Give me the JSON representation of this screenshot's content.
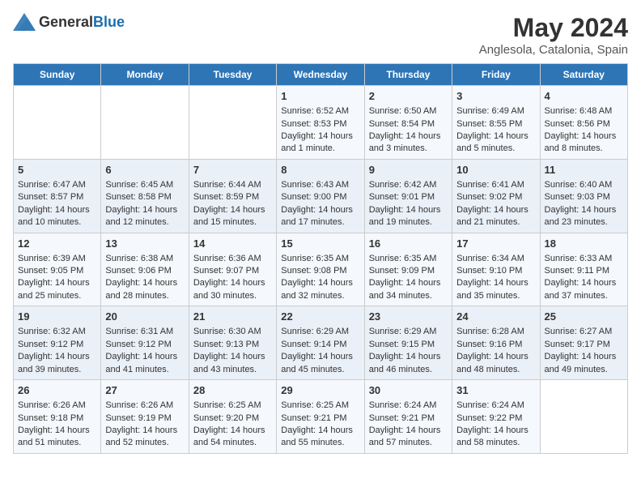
{
  "logo": {
    "text_general": "General",
    "text_blue": "Blue"
  },
  "title": "May 2024",
  "subtitle": "Anglesola, Catalonia, Spain",
  "days_header": [
    "Sunday",
    "Monday",
    "Tuesday",
    "Wednesday",
    "Thursday",
    "Friday",
    "Saturday"
  ],
  "weeks": [
    [
      {
        "day": "",
        "info": ""
      },
      {
        "day": "",
        "info": ""
      },
      {
        "day": "",
        "info": ""
      },
      {
        "day": "1",
        "info": "Sunrise: 6:52 AM\nSunset: 8:53 PM\nDaylight: 14 hours\nand 1 minute."
      },
      {
        "day": "2",
        "info": "Sunrise: 6:50 AM\nSunset: 8:54 PM\nDaylight: 14 hours\nand 3 minutes."
      },
      {
        "day": "3",
        "info": "Sunrise: 6:49 AM\nSunset: 8:55 PM\nDaylight: 14 hours\nand 5 minutes."
      },
      {
        "day": "4",
        "info": "Sunrise: 6:48 AM\nSunset: 8:56 PM\nDaylight: 14 hours\nand 8 minutes."
      }
    ],
    [
      {
        "day": "5",
        "info": "Sunrise: 6:47 AM\nSunset: 8:57 PM\nDaylight: 14 hours\nand 10 minutes."
      },
      {
        "day": "6",
        "info": "Sunrise: 6:45 AM\nSunset: 8:58 PM\nDaylight: 14 hours\nand 12 minutes."
      },
      {
        "day": "7",
        "info": "Sunrise: 6:44 AM\nSunset: 8:59 PM\nDaylight: 14 hours\nand 15 minutes."
      },
      {
        "day": "8",
        "info": "Sunrise: 6:43 AM\nSunset: 9:00 PM\nDaylight: 14 hours\nand 17 minutes."
      },
      {
        "day": "9",
        "info": "Sunrise: 6:42 AM\nSunset: 9:01 PM\nDaylight: 14 hours\nand 19 minutes."
      },
      {
        "day": "10",
        "info": "Sunrise: 6:41 AM\nSunset: 9:02 PM\nDaylight: 14 hours\nand 21 minutes."
      },
      {
        "day": "11",
        "info": "Sunrise: 6:40 AM\nSunset: 9:03 PM\nDaylight: 14 hours\nand 23 minutes."
      }
    ],
    [
      {
        "day": "12",
        "info": "Sunrise: 6:39 AM\nSunset: 9:05 PM\nDaylight: 14 hours\nand 25 minutes."
      },
      {
        "day": "13",
        "info": "Sunrise: 6:38 AM\nSunset: 9:06 PM\nDaylight: 14 hours\nand 28 minutes."
      },
      {
        "day": "14",
        "info": "Sunrise: 6:36 AM\nSunset: 9:07 PM\nDaylight: 14 hours\nand 30 minutes."
      },
      {
        "day": "15",
        "info": "Sunrise: 6:35 AM\nSunset: 9:08 PM\nDaylight: 14 hours\nand 32 minutes."
      },
      {
        "day": "16",
        "info": "Sunrise: 6:35 AM\nSunset: 9:09 PM\nDaylight: 14 hours\nand 34 minutes."
      },
      {
        "day": "17",
        "info": "Sunrise: 6:34 AM\nSunset: 9:10 PM\nDaylight: 14 hours\nand 35 minutes."
      },
      {
        "day": "18",
        "info": "Sunrise: 6:33 AM\nSunset: 9:11 PM\nDaylight: 14 hours\nand 37 minutes."
      }
    ],
    [
      {
        "day": "19",
        "info": "Sunrise: 6:32 AM\nSunset: 9:12 PM\nDaylight: 14 hours\nand 39 minutes."
      },
      {
        "day": "20",
        "info": "Sunrise: 6:31 AM\nSunset: 9:12 PM\nDaylight: 14 hours\nand 41 minutes."
      },
      {
        "day": "21",
        "info": "Sunrise: 6:30 AM\nSunset: 9:13 PM\nDaylight: 14 hours\nand 43 minutes."
      },
      {
        "day": "22",
        "info": "Sunrise: 6:29 AM\nSunset: 9:14 PM\nDaylight: 14 hours\nand 45 minutes."
      },
      {
        "day": "23",
        "info": "Sunrise: 6:29 AM\nSunset: 9:15 PM\nDaylight: 14 hours\nand 46 minutes."
      },
      {
        "day": "24",
        "info": "Sunrise: 6:28 AM\nSunset: 9:16 PM\nDaylight: 14 hours\nand 48 minutes."
      },
      {
        "day": "25",
        "info": "Sunrise: 6:27 AM\nSunset: 9:17 PM\nDaylight: 14 hours\nand 49 minutes."
      }
    ],
    [
      {
        "day": "26",
        "info": "Sunrise: 6:26 AM\nSunset: 9:18 PM\nDaylight: 14 hours\nand 51 minutes."
      },
      {
        "day": "27",
        "info": "Sunrise: 6:26 AM\nSunset: 9:19 PM\nDaylight: 14 hours\nand 52 minutes."
      },
      {
        "day": "28",
        "info": "Sunrise: 6:25 AM\nSunset: 9:20 PM\nDaylight: 14 hours\nand 54 minutes."
      },
      {
        "day": "29",
        "info": "Sunrise: 6:25 AM\nSunset: 9:21 PM\nDaylight: 14 hours\nand 55 minutes."
      },
      {
        "day": "30",
        "info": "Sunrise: 6:24 AM\nSunset: 9:21 PM\nDaylight: 14 hours\nand 57 minutes."
      },
      {
        "day": "31",
        "info": "Sunrise: 6:24 AM\nSunset: 9:22 PM\nDaylight: 14 hours\nand 58 minutes."
      },
      {
        "day": "",
        "info": ""
      }
    ]
  ]
}
